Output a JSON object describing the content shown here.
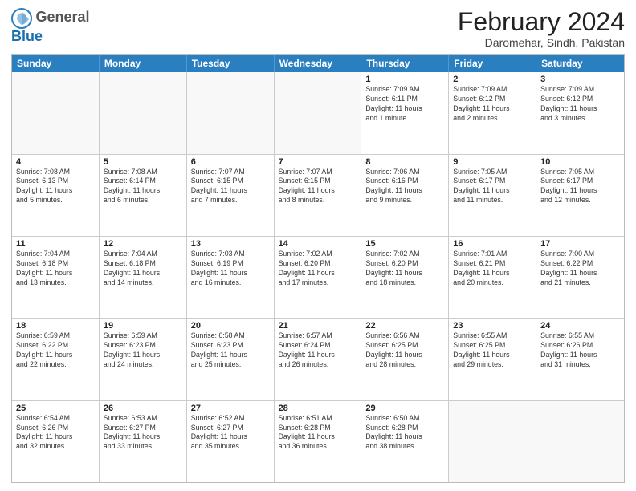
{
  "header": {
    "logo_general": "General",
    "logo_blue": "Blue",
    "month_year": "February 2024",
    "location": "Daromehar, Sindh, Pakistan"
  },
  "days_of_week": [
    "Sunday",
    "Monday",
    "Tuesday",
    "Wednesday",
    "Thursday",
    "Friday",
    "Saturday"
  ],
  "weeks": [
    [
      {
        "day": "",
        "info": ""
      },
      {
        "day": "",
        "info": ""
      },
      {
        "day": "",
        "info": ""
      },
      {
        "day": "",
        "info": ""
      },
      {
        "day": "1",
        "info": "Sunrise: 7:09 AM\nSunset: 6:11 PM\nDaylight: 11 hours\nand 1 minute."
      },
      {
        "day": "2",
        "info": "Sunrise: 7:09 AM\nSunset: 6:12 PM\nDaylight: 11 hours\nand 2 minutes."
      },
      {
        "day": "3",
        "info": "Sunrise: 7:09 AM\nSunset: 6:12 PM\nDaylight: 11 hours\nand 3 minutes."
      }
    ],
    [
      {
        "day": "4",
        "info": "Sunrise: 7:08 AM\nSunset: 6:13 PM\nDaylight: 11 hours\nand 5 minutes."
      },
      {
        "day": "5",
        "info": "Sunrise: 7:08 AM\nSunset: 6:14 PM\nDaylight: 11 hours\nand 6 minutes."
      },
      {
        "day": "6",
        "info": "Sunrise: 7:07 AM\nSunset: 6:15 PM\nDaylight: 11 hours\nand 7 minutes."
      },
      {
        "day": "7",
        "info": "Sunrise: 7:07 AM\nSunset: 6:15 PM\nDaylight: 11 hours\nand 8 minutes."
      },
      {
        "day": "8",
        "info": "Sunrise: 7:06 AM\nSunset: 6:16 PM\nDaylight: 11 hours\nand 9 minutes."
      },
      {
        "day": "9",
        "info": "Sunrise: 7:05 AM\nSunset: 6:17 PM\nDaylight: 11 hours\nand 11 minutes."
      },
      {
        "day": "10",
        "info": "Sunrise: 7:05 AM\nSunset: 6:17 PM\nDaylight: 11 hours\nand 12 minutes."
      }
    ],
    [
      {
        "day": "11",
        "info": "Sunrise: 7:04 AM\nSunset: 6:18 PM\nDaylight: 11 hours\nand 13 minutes."
      },
      {
        "day": "12",
        "info": "Sunrise: 7:04 AM\nSunset: 6:18 PM\nDaylight: 11 hours\nand 14 minutes."
      },
      {
        "day": "13",
        "info": "Sunrise: 7:03 AM\nSunset: 6:19 PM\nDaylight: 11 hours\nand 16 minutes."
      },
      {
        "day": "14",
        "info": "Sunrise: 7:02 AM\nSunset: 6:20 PM\nDaylight: 11 hours\nand 17 minutes."
      },
      {
        "day": "15",
        "info": "Sunrise: 7:02 AM\nSunset: 6:20 PM\nDaylight: 11 hours\nand 18 minutes."
      },
      {
        "day": "16",
        "info": "Sunrise: 7:01 AM\nSunset: 6:21 PM\nDaylight: 11 hours\nand 20 minutes."
      },
      {
        "day": "17",
        "info": "Sunrise: 7:00 AM\nSunset: 6:22 PM\nDaylight: 11 hours\nand 21 minutes."
      }
    ],
    [
      {
        "day": "18",
        "info": "Sunrise: 6:59 AM\nSunset: 6:22 PM\nDaylight: 11 hours\nand 22 minutes."
      },
      {
        "day": "19",
        "info": "Sunrise: 6:59 AM\nSunset: 6:23 PM\nDaylight: 11 hours\nand 24 minutes."
      },
      {
        "day": "20",
        "info": "Sunrise: 6:58 AM\nSunset: 6:23 PM\nDaylight: 11 hours\nand 25 minutes."
      },
      {
        "day": "21",
        "info": "Sunrise: 6:57 AM\nSunset: 6:24 PM\nDaylight: 11 hours\nand 26 minutes."
      },
      {
        "day": "22",
        "info": "Sunrise: 6:56 AM\nSunset: 6:25 PM\nDaylight: 11 hours\nand 28 minutes."
      },
      {
        "day": "23",
        "info": "Sunrise: 6:55 AM\nSunset: 6:25 PM\nDaylight: 11 hours\nand 29 minutes."
      },
      {
        "day": "24",
        "info": "Sunrise: 6:55 AM\nSunset: 6:26 PM\nDaylight: 11 hours\nand 31 minutes."
      }
    ],
    [
      {
        "day": "25",
        "info": "Sunrise: 6:54 AM\nSunset: 6:26 PM\nDaylight: 11 hours\nand 32 minutes."
      },
      {
        "day": "26",
        "info": "Sunrise: 6:53 AM\nSunset: 6:27 PM\nDaylight: 11 hours\nand 33 minutes."
      },
      {
        "day": "27",
        "info": "Sunrise: 6:52 AM\nSunset: 6:27 PM\nDaylight: 11 hours\nand 35 minutes."
      },
      {
        "day": "28",
        "info": "Sunrise: 6:51 AM\nSunset: 6:28 PM\nDaylight: 11 hours\nand 36 minutes."
      },
      {
        "day": "29",
        "info": "Sunrise: 6:50 AM\nSunset: 6:28 PM\nDaylight: 11 hours\nand 38 minutes."
      },
      {
        "day": "",
        "info": ""
      },
      {
        "day": "",
        "info": ""
      }
    ]
  ]
}
